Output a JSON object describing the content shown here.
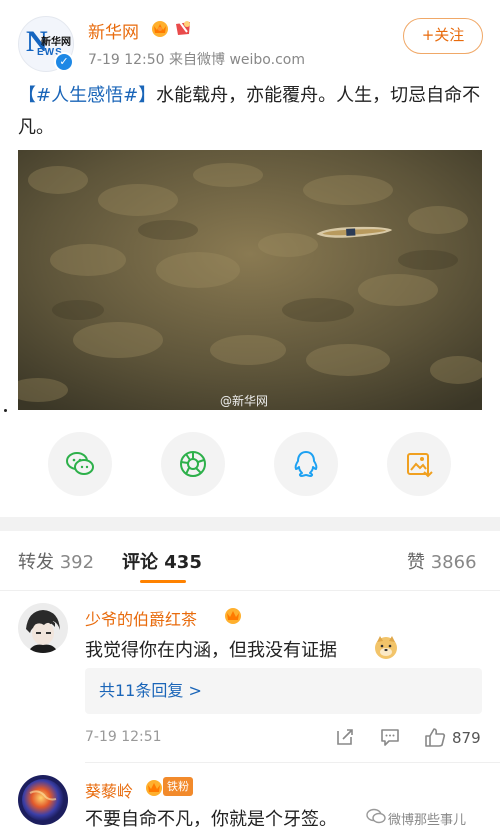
{
  "post": {
    "author": "新华网",
    "meta": "7-19 12:50  来自微博 weibo.com",
    "follow_label": "+关注",
    "avatar_text": "新华网",
    "avatar_letters": "NEWS",
    "tag": "【#人生感悟#】",
    "body": "水能载舟，亦能覆舟。人生，切忌自命不凡。",
    "image_watermark": "@新华网"
  },
  "share": [
    "wechat-icon",
    "moments-icon",
    "qq-icon",
    "save-image-icon"
  ],
  "tabs": {
    "repost_label": "转发",
    "repost_count": "392",
    "comment_label": "评论",
    "comment_count": "435",
    "like_label": "赞",
    "like_count": "3866"
  },
  "comments": [
    {
      "name": "少爷的伯爵红茶",
      "text": "我觉得你在内涵，但我没有证据",
      "replies": "共11条回复 >",
      "time": "7-19 12:51",
      "likes": "879"
    },
    {
      "name": "葵藜岭",
      "badge": "铁粉",
      "text": "不要自命不凡，你就是个牙签。"
    }
  ],
  "watermark": "微博那些事儿",
  "colors": {
    "accent": "#ff8200",
    "name": "#e86b0d",
    "link": "#1a65b8"
  }
}
